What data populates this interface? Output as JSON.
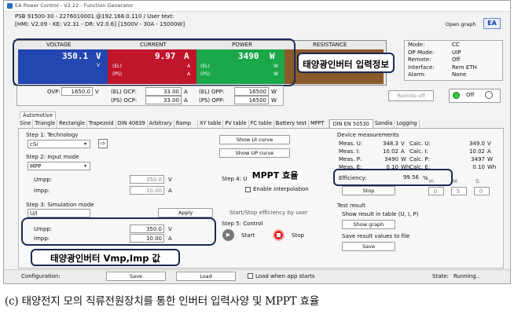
{
  "title": "EA Power Control - V2.22 - Function Generator",
  "device_line1": "PSB 91500-30 - 2276010001 @192.168.0.110 / User text:",
  "device_line2": "[HMI: V2.09 - KE: V2.31 - DR: V2.0.6] [1500V - 30A - 15000W]",
  "open_graph": "Open graph",
  "logo": "EA",
  "meters": {
    "voltage": {
      "label": "VOLTAGE",
      "value": "350.1",
      "unit": "V",
      "sub_unit": "V"
    },
    "current": {
      "label": "CURRENT",
      "value": "9.97",
      "unit": "A",
      "el": "(EL)",
      "ps": "(PS)",
      "el_unit": "A",
      "ps_unit": "A"
    },
    "power": {
      "label": "POWER",
      "value": "3490",
      "unit": "W",
      "el": "(EL)",
      "ps": "(PS)",
      "el_unit": "W",
      "ps_unit": "W"
    },
    "resistance": {
      "label": "RESISTANCE"
    }
  },
  "callout_input": "태양광인버터 입력정보",
  "callout_mppt": "MPPT 효율",
  "callout_vmp": "태양광인버터 Vmp,Imp 값",
  "status": [
    {
      "k": "Mode:",
      "v": "CC"
    },
    {
      "k": "OP Mode:",
      "v": "UIP"
    },
    {
      "k": "Remote:",
      "v": "Off"
    },
    {
      "k": "Interface:",
      "v": "Rem ETH"
    },
    {
      "k": "Alarm:",
      "v": "None"
    }
  ],
  "limits": {
    "ovp_label": "OVP:",
    "ovp": "1650.0",
    "ovp_unit": "V",
    "el_ocp_label": "(EL) OCP:",
    "el_ocp": "33.00",
    "el_ocp_unit": "A",
    "ps_ocp_label": "(PS) OCP:",
    "ps_ocp": "33.00",
    "ps_ocp_unit": "A",
    "el_opp_label": "(EL) OPP:",
    "el_opp": "16500",
    "el_opp_unit": "W",
    "ps_opp_label": "(PS) OPP:",
    "ps_opp": "16500",
    "ps_opp_unit": "W"
  },
  "remote_off": "Remote off",
  "power_state": "Off",
  "section_tab": "Automotive",
  "tabs": [
    "Sine",
    "Triangle",
    "Rectangle",
    "Trapezoid",
    "DIN 40839",
    "Arbitrary",
    "Ramp",
    "XY table",
    "PV table",
    "FC table",
    "Battery test",
    "MPPT",
    "DIN EN 50530",
    "Sandia",
    "Logging"
  ],
  "active_tab_index": 12,
  "step1": {
    "label": "Step 1: Technology",
    "value": "cSi"
  },
  "step2": {
    "label": "Step 2: Input mode",
    "value": "MPP",
    "umpp_label": "Umpp:",
    "umpp": "350.0",
    "umpp_unit": "V",
    "impp_label": "Impp:",
    "impp": "10.00",
    "impp_unit": "A"
  },
  "step3": {
    "label": "Step 3: Simulation mode",
    "value": "U/I",
    "apply": "Apply",
    "umpp_label": "Umpp:",
    "umpp": "350.0",
    "umpp_unit": "V",
    "impp_label": "Impp:",
    "impp": "10.00",
    "impp_unit": "A"
  },
  "show_ui": "Show UI curve",
  "show_up": "Show UP curve",
  "step4": {
    "label": "Step 4: Up",
    "interp": "Enable interpolation"
  },
  "startstop_label": "Start/Stop efficiency by user",
  "step5": {
    "label": "Step 5: Control",
    "start": "Start",
    "stop": "Stop"
  },
  "dm": {
    "title": "Device measurements",
    "rows": [
      {
        "k": "Meas. U:",
        "v": "348.3",
        "u": "V",
        "k2": "Calc. U:",
        "v2": "349.0",
        "u2": "V"
      },
      {
        "k": "Meas. I:",
        "v": "10.02",
        "u": "A",
        "k2": "Calc. I:",
        "v2": "10.02",
        "u2": "A"
      },
      {
        "k": "Meas. P:",
        "v": "3490",
        "u": "W",
        "k2": "Calc. P:",
        "v2": "3497",
        "u2": "W"
      },
      {
        "k": "Meas. E:",
        "v": "0.10",
        "u": "Wh",
        "k2": "Calc. E:",
        "v2": "0.10",
        "u2": "Wh"
      }
    ],
    "eff_label": "Efficiency:",
    "eff": "99.56",
    "eff_unit": "%",
    "stop": "Stop",
    "h": "H:",
    "m": "M:",
    "s": "S:",
    "hv": "0",
    "mv": "5",
    "sv": "0"
  },
  "test": {
    "title": "Test result",
    "show_table": "Show result in table (U, I, P)",
    "show_graph": "Show graph",
    "save_label": "Save result values to file",
    "save": "Save"
  },
  "bottom": {
    "config": "Configuration:",
    "save": "Save",
    "load": "Load",
    "load_start": "Load when app starts",
    "state_label": "State:",
    "state": "Running.."
  },
  "caption": "(c) 태양전지 모의 직류전원장치를 통한 인버터 입력사양 및 MPPT 효율",
  "colors": {
    "voltage": "#d42020",
    "current": "#c0152b",
    "power": "#1aa84a",
    "resistance": "#8b5a2b",
    "voltage_bg": "#2346b0"
  }
}
